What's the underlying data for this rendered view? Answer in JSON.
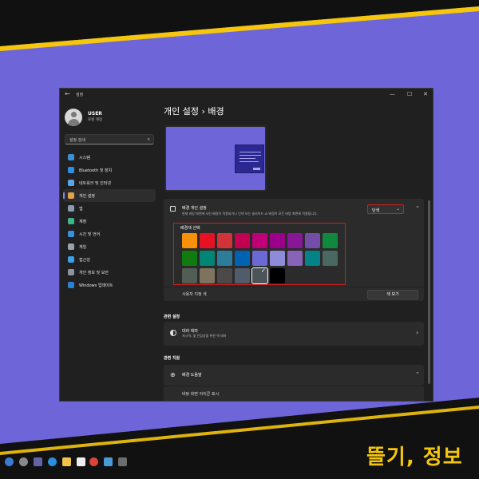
{
  "window": {
    "app_title": "설정",
    "back_glyph": "←",
    "controls": {
      "minimize": "—",
      "maximize": "☐",
      "close": "✕"
    }
  },
  "user": {
    "name": "USER",
    "subtitle": "로컬 계정"
  },
  "search": {
    "placeholder": "설정 검색",
    "icon": "search-icon"
  },
  "sidebar": {
    "items": [
      {
        "label": "시스템",
        "icon": "system-icon",
        "color": "#3b8fd6"
      },
      {
        "label": "Bluetooth 및 장치",
        "icon": "bluetooth-icon",
        "color": "#2f8de4"
      },
      {
        "label": "네트워크 및 인터넷",
        "icon": "network-icon",
        "color": "#5aa6e8"
      },
      {
        "label": "개인 설정",
        "icon": "brush-icon",
        "color": "#e0a24a",
        "active": true
      },
      {
        "label": "앱",
        "icon": "apps-icon",
        "color": "#8a9bb0"
      },
      {
        "label": "계정",
        "icon": "account-icon",
        "color": "#3fb58c"
      },
      {
        "label": "시간 및 언어",
        "icon": "time-language-icon",
        "color": "#3a8fdc"
      },
      {
        "label": "게임",
        "icon": "gaming-icon",
        "color": "#9aa3ad"
      },
      {
        "label": "접근성",
        "icon": "accessibility-icon",
        "color": "#3aa0e8"
      },
      {
        "label": "개인 정보 및 보안",
        "icon": "shield-icon",
        "color": "#8f959c"
      },
      {
        "label": "Windows 업데이트",
        "icon": "update-icon",
        "color": "#2c7fd4"
      }
    ]
  },
  "breadcrumb": {
    "parent": "개인 설정",
    "separator": "›",
    "current": "배경"
  },
  "background_card": {
    "title": "배경 개인 설정",
    "description": "현재 바탕 화면에 사진 배경이 적용되거나 단색 또는 슬라이드 쇼 배경이 모든 바탕 화면에 적용됩니다.",
    "dropdown_value": "단색",
    "highlight_color": "#cc1f1f"
  },
  "palette": {
    "title": "배경색 선택",
    "selected_index": 22,
    "colors": [
      "#f7910a",
      "#e81123",
      "#d13438",
      "#c30052",
      "#bf0077",
      "#9a0089",
      "#881798",
      "#744da9",
      "#10893e",
      "#107c10",
      "#018574",
      "#2d7d9a",
      "#0063b1",
      "#6b69d6",
      "#8e8cd8",
      "#8764b8",
      "#038387",
      "#486860",
      "#525e54",
      "#7e735f",
      "#4c4a48",
      "#515c6b",
      "#4a5459",
      "#000000"
    ]
  },
  "custom_color": {
    "label": "사용자 지정 색",
    "button": "색 보기"
  },
  "related_settings": {
    "section_title": "관련 설정",
    "theme_title": "대비 테마",
    "theme_desc": "저시력, 빛 민감성을 위한 색 테마"
  },
  "related_help": {
    "section_title": "관련 지원",
    "help_title": "배경 도움말",
    "help_item": "바탕 화면 아이콘 표시"
  },
  "brand": {
    "text": "뜰기, 정보",
    "color": "#f5c60c"
  },
  "colors": {
    "backdrop": "#6e66d8",
    "window": "#202020",
    "card": "#2b2b2b",
    "accent": "#8a86e8"
  }
}
